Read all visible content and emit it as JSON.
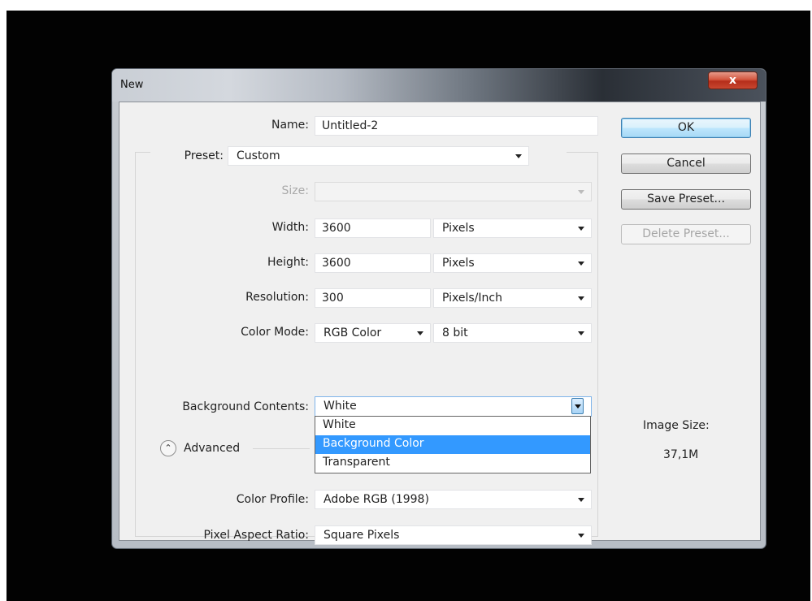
{
  "window": {
    "title": "New",
    "close_glyph": "x"
  },
  "form": {
    "name_label": "Name:",
    "name_value": "Untitled-2",
    "preset_label": "Preset:",
    "preset_value": "Custom",
    "size_label": "Size:",
    "size_value": "",
    "width_label": "Width:",
    "width_value": "3600",
    "width_unit": "Pixels",
    "height_label": "Height:",
    "height_value": "3600",
    "height_unit": "Pixels",
    "resolution_label": "Resolution:",
    "resolution_value": "300",
    "resolution_unit": "Pixels/Inch",
    "color_mode_label": "Color Mode:",
    "color_mode_value": "RGB Color",
    "bit_depth_value": "8 bit",
    "bg_contents_label": "Background Contents:",
    "bg_contents_value": "White",
    "bg_contents_options": [
      "White",
      "Background Color",
      "Transparent"
    ],
    "bg_contents_highlighted": "Background Color",
    "advanced_label": "Advanced",
    "color_profile_label": "Color Profile:",
    "color_profile_value": "Adobe RGB (1998)",
    "pixel_aspect_label": "Pixel Aspect Ratio:",
    "pixel_aspect_value": "Square Pixels"
  },
  "buttons": {
    "ok": "OK",
    "cancel": "Cancel",
    "save_preset": "Save Preset...",
    "delete_preset": "Delete Preset..."
  },
  "image_size": {
    "label": "Image Size:",
    "value": "37,1M"
  },
  "icons": {
    "close": "close-icon",
    "dropdown_arrow": "chevron-down-icon",
    "advanced_toggle": "double-chevron-up-icon"
  },
  "colors": {
    "selection": "#3399ff",
    "default_button_border": "#3c7fb1",
    "close_button": "#c8462f"
  }
}
